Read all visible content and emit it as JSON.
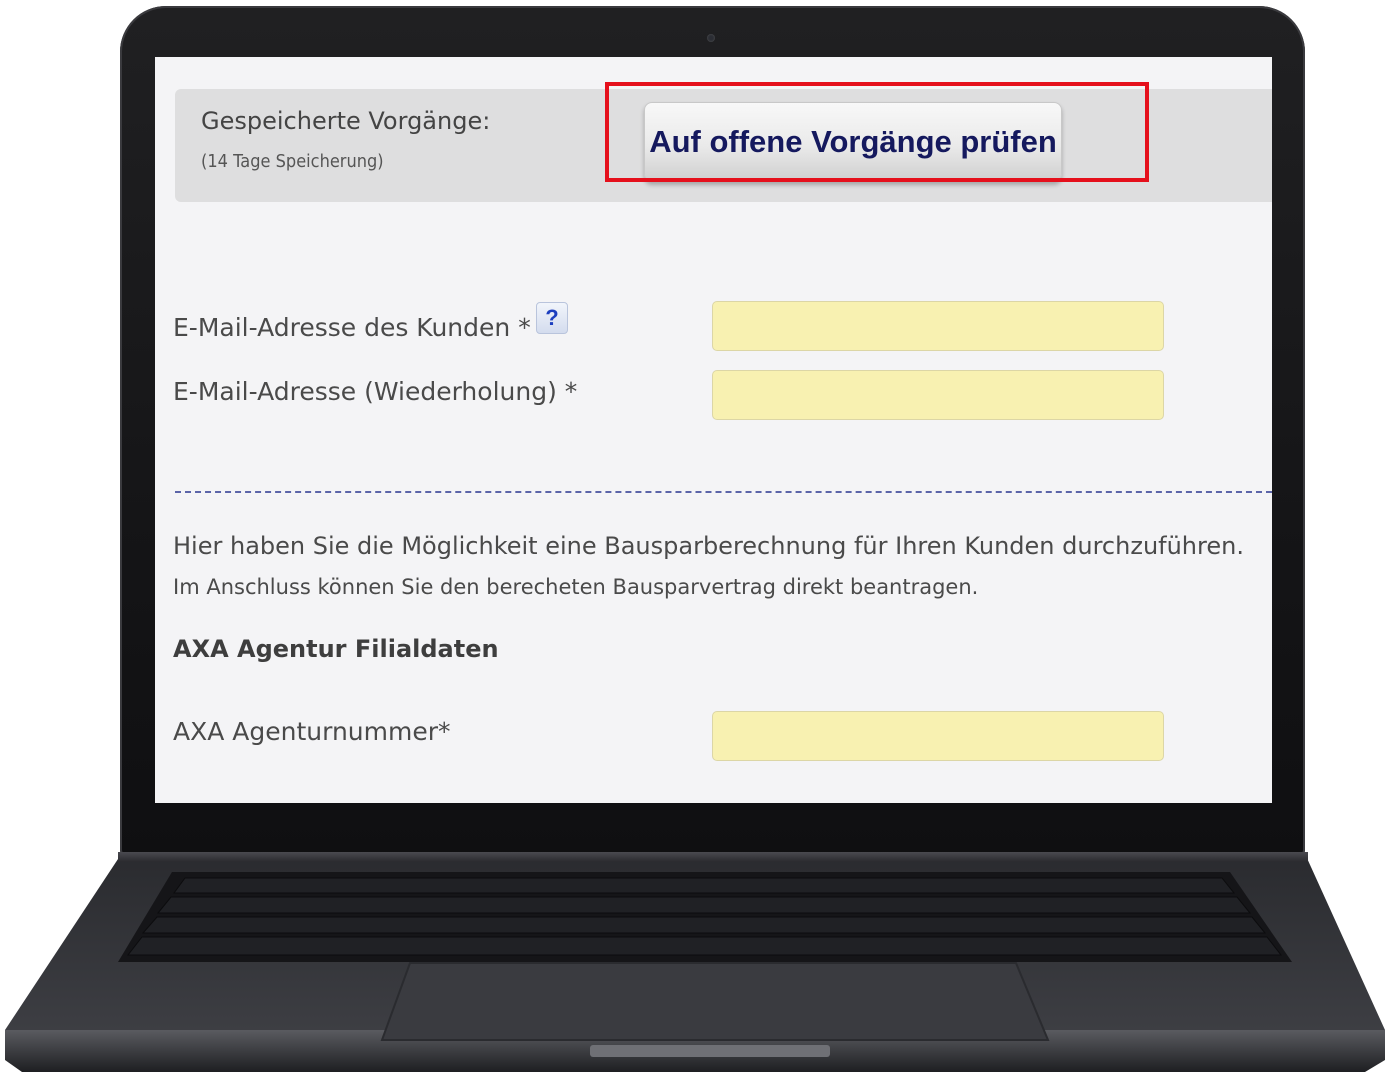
{
  "saved": {
    "label": "Gespeicherte Vorgänge:",
    "retention": "(14 Tage Speicherung)",
    "check_button": "Auf offene Vorgänge prüfen"
  },
  "form": {
    "email_label": "E-Mail-Adresse des Kunden *",
    "help_glyph": "?",
    "email_repeat_label": "E-Mail-Adresse (Wiederholung) *",
    "email_value": "",
    "email_repeat_value": ""
  },
  "info": {
    "line1": "Hier haben Sie die Möglichkeit eine Bausparberechnung für Ihren Kunden durchzuführen.",
    "line2": "Im Anschluss können Sie den berecheten Bausparvertrag direkt beantragen."
  },
  "agency": {
    "section_title": "AXA Agentur Filialdaten",
    "number_label": "AXA Agenturnummer*",
    "number_value": ""
  },
  "colors": {
    "field_bg": "#f8f1b1",
    "highlight": "#e5101c",
    "button_text": "#15195e"
  }
}
